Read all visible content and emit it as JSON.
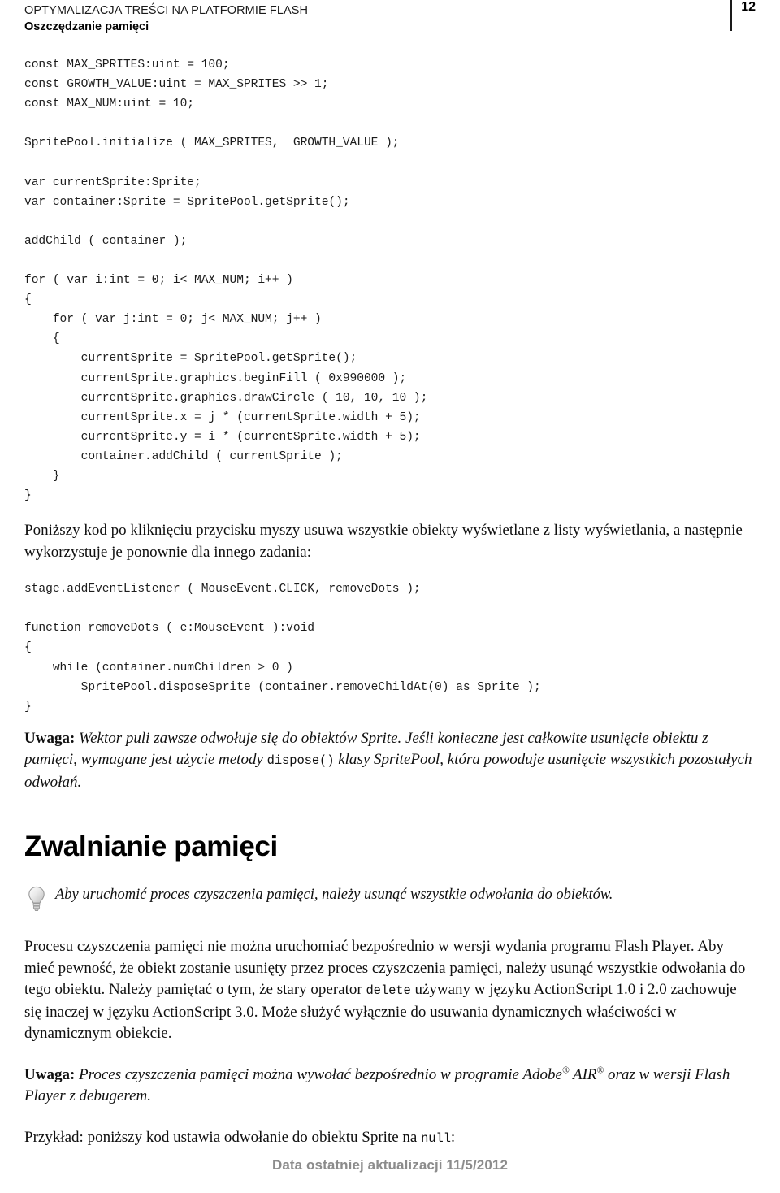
{
  "header": {
    "running_title": "OPTYMALIZACJA TREŚCI NA PLATFORMIE FLASH",
    "running_subtitle": "Oszczędzanie pamięci",
    "page_number": "12"
  },
  "content": {
    "code_block_1": "const MAX_SPRITES:uint = 100;\nconst GROWTH_VALUE:uint = MAX_SPRITES >> 1;\nconst MAX_NUM:uint = 10;\n\nSpritePool.initialize ( MAX_SPRITES,  GROWTH_VALUE );\n\nvar currentSprite:Sprite;\nvar container:Sprite = SpritePool.getSprite();\n\naddChild ( container );\n\nfor ( var i:int = 0; i< MAX_NUM; i++ )\n{\n    for ( var j:int = 0; j< MAX_NUM; j++ )\n    {\n        currentSprite = SpritePool.getSprite();\n        currentSprite.graphics.beginFill ( 0x990000 );\n        currentSprite.graphics.drawCircle ( 10, 10, 10 );\n        currentSprite.x = j * (currentSprite.width + 5);\n        currentSprite.y = i * (currentSprite.width + 5);\n        container.addChild ( currentSprite );\n    }\n}",
    "paragraph_1": "Poniższy kod po kliknięciu przycisku myszy usuwa wszystkie obiekty wyświetlane z listy wyświetlania, a następnie wykorzystuje je ponownie dla innego zadania:",
    "code_block_2": "stage.addEventListener ( MouseEvent.CLICK, removeDots );\n\nfunction removeDots ( e:MouseEvent ):void\n{\n    while (container.numChildren > 0 )\n        SpritePool.disposeSprite (container.removeChildAt(0) as Sprite );\n}",
    "note_1": {
      "label": "Uwaga:",
      "text_before_code": " Wektor puli zawsze odwołuje się do obiektów Sprite. Jeśli konieczne jest całkowite usunięcie obiektu z pamięci, wymagane jest użycie metody ",
      "code": "dispose()",
      "text_after_code": " klasy SpritePool, która powoduje usunięcie wszystkich pozostałych odwołań."
    },
    "section_heading": "Zwalnianie pamięci",
    "tip": {
      "icon": "lightbulb-icon",
      "text": "Aby uruchomić proces czyszczenia pamięci, należy usunąć wszystkie odwołania do obiektów."
    },
    "paragraph_2": {
      "part1": "Procesu czyszczenia pamięci nie można uruchomiać bezpośrednio w wersji wydania programu Flash Player. Aby mieć pewność, że obiekt zostanie usunięty przez proces czyszczenia pamięci, należy usunąć wszystkie odwołania do tego obiektu. Należy pamiętać o tym, że stary operator ",
      "code": "delete",
      "part2": " używany w języku ActionScript 1.0 i 2.0 zachowuje się inaczej w języku ActionScript 3.0. Może służyć wyłącznie do usuwania dynamicznych właściwości w dynamicznym obiekcie."
    },
    "note_2": {
      "label": "Uwaga:",
      "part1": " Proces czyszczenia pamięci można wywołać bezpośrednio w programie Adobe",
      "reg1": "®",
      "part2": " AIR",
      "reg2": "®",
      "part3": " oraz w wersji Flash Player z debugerem."
    },
    "paragraph_3": {
      "part1": "Przykład: poniższy kod ustawia odwołanie do obiektu Sprite na ",
      "code": "null",
      "part2": ":"
    }
  },
  "footer": {
    "text": "Data ostatniej aktualizacji 11/5/2012",
    "color": "#8c8c8c"
  }
}
